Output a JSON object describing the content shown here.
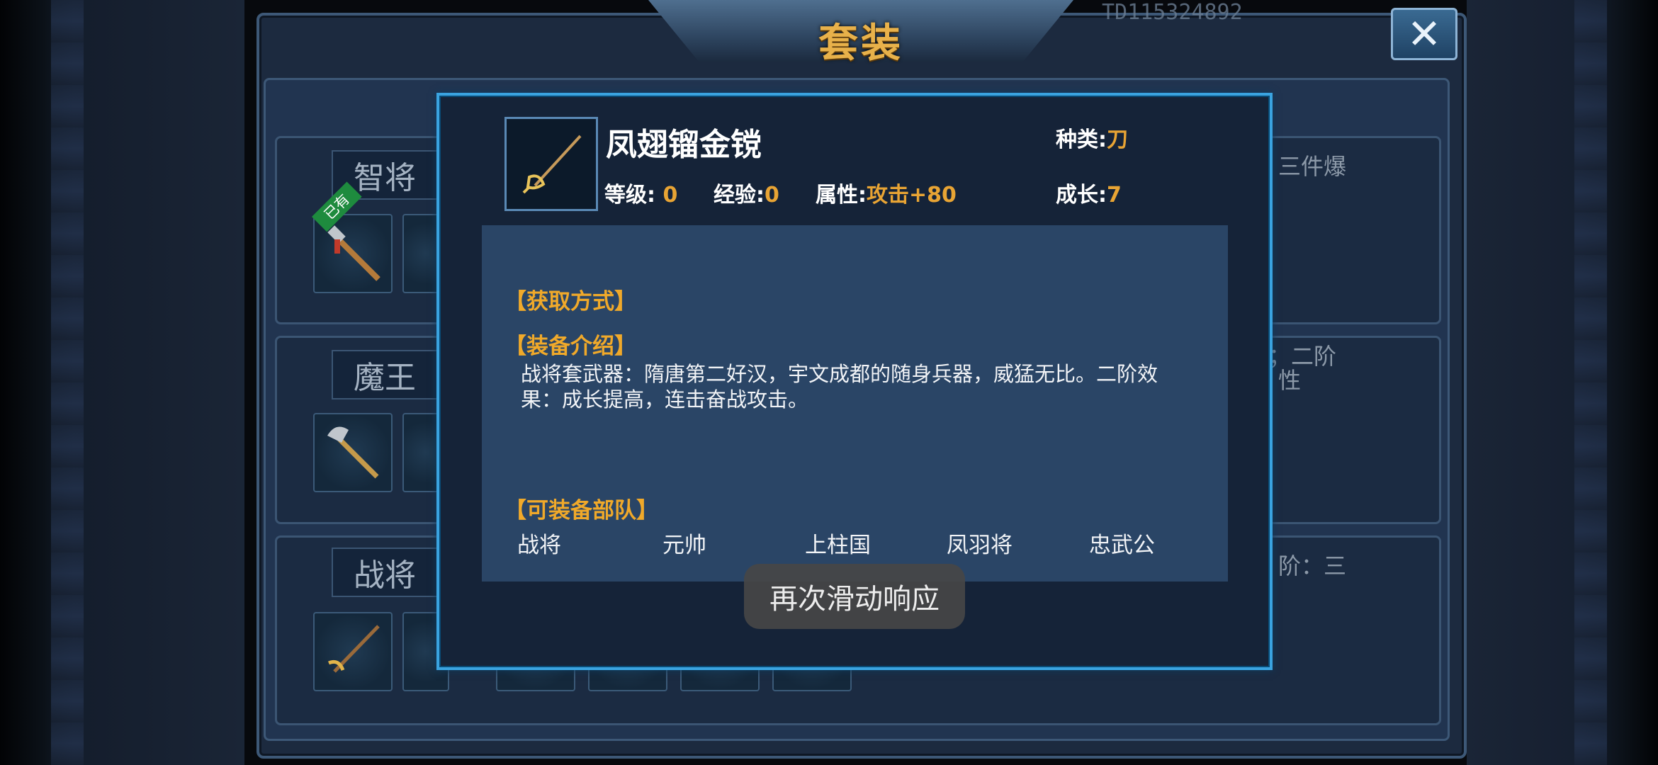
{
  "window": {
    "title": "套装",
    "close_label": "✕",
    "top_id": "TD115324892"
  },
  "background": {
    "sets": [
      {
        "name": "智将",
        "owned_tag": "已有",
        "side_text": "三件爆"
      },
      {
        "name": "魔王",
        "side_text_1": "；二阶",
        "side_text_2": "性"
      },
      {
        "name": "战将",
        "side_text": "阶：三"
      }
    ]
  },
  "item": {
    "name": "凤翅镏金镋",
    "level_label": "等级:",
    "level_value": "0",
    "exp_label": "经验:",
    "exp_value": "0",
    "attr_label": "属性:",
    "attr_value": "攻击+80",
    "type_label": "种类:",
    "type_value": "刀",
    "growth_label": "成长:",
    "growth_value": "7",
    "icon": "spear-icon"
  },
  "sections": {
    "obtain_title": "【获取方式】",
    "intro_title": "【装备介绍】",
    "intro_line1": "战将套武器：隋唐第二好汉，宇文成都的随身兵器，威猛无比。二阶效",
    "intro_line2": "果：成长提高，连击奋战攻击。",
    "troops_title": "【可装备部队】",
    "troops": [
      "战将",
      "元帅",
      "上柱国",
      "凤羽将",
      "忠武公"
    ]
  },
  "toast": {
    "text": "再次滑动响应"
  },
  "colors": {
    "accent_gold": "#e8a434",
    "modal_border": "#3aa3e0",
    "section_orange": "#f0a92a"
  }
}
